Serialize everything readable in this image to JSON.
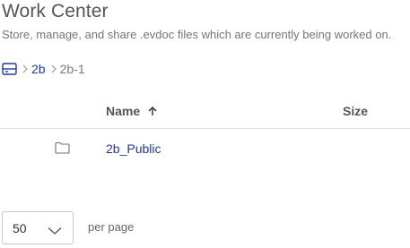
{
  "header": {
    "title": "Work Center",
    "subtitle": "Store, manage, and share .evdoc files which are currently being worked on."
  },
  "breadcrumb": {
    "home_icon": "drive-icon",
    "items": [
      "2b",
      "2b-1"
    ]
  },
  "table": {
    "columns": {
      "name": "Name",
      "size": "Size"
    },
    "sort": {
      "column": "Name",
      "direction": "ascending",
      "icon": "arrow-up-icon"
    },
    "rows": [
      {
        "icon": "folder-icon",
        "name": "2b_Public",
        "size": ""
      }
    ]
  },
  "pagination": {
    "per_page_value": "50",
    "per_page_label": "per page",
    "chevron_icon": "chevron-down-icon"
  },
  "colors": {
    "link": "#1f3a93",
    "title": "#555555",
    "divider": "#e0e0e0"
  }
}
